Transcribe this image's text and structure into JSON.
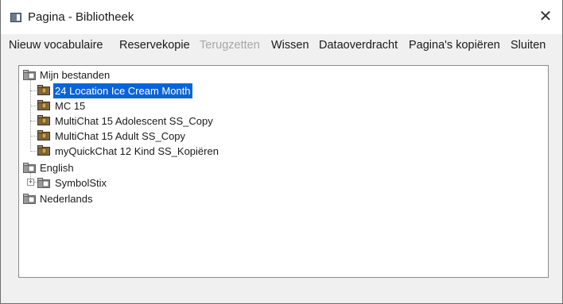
{
  "window": {
    "title": "Pagina - Bibliotheek",
    "icon": "app-window-icon",
    "close_glyph": "✕"
  },
  "menu": {
    "items": [
      {
        "label": "Nieuw vocabulaire",
        "enabled": true
      },
      {
        "label": "Reservekopie",
        "enabled": true
      },
      {
        "label": "Terugzetten",
        "enabled": false
      },
      {
        "label": "Wissen",
        "enabled": true
      },
      {
        "label": "Dataoverdracht",
        "enabled": true
      },
      {
        "label": "Pagina's kopiëren",
        "enabled": true
      },
      {
        "label": "Sluiten",
        "enabled": true
      }
    ]
  },
  "tree": {
    "nodes": [
      {
        "label": "Mijn bestanden",
        "level": 0,
        "icon": "folder-icon",
        "expanded": true
      },
      {
        "label": "24 Location Ice Cream Month",
        "level": 1,
        "icon": "vocabulary-icon",
        "selected": true
      },
      {
        "label": "MC 15",
        "level": 1,
        "icon": "vocabulary-icon"
      },
      {
        "label": "MultiChat 15 Adolescent SS_Copy",
        "level": 1,
        "icon": "vocabulary-icon"
      },
      {
        "label": "MultiChat 15 Adult SS_Copy",
        "level": 1,
        "icon": "vocabulary-icon"
      },
      {
        "label": "myQuickChat 12 Kind SS_Kopiëren",
        "level": 1,
        "icon": "vocabulary-icon"
      },
      {
        "label": "English",
        "level": 0,
        "icon": "folder-icon"
      },
      {
        "label": "SymbolStix",
        "level": 1,
        "icon": "folder-icon",
        "collapsed": true,
        "expander": "+"
      },
      {
        "label": "Nederlands",
        "level": 0,
        "icon": "folder-icon"
      }
    ]
  },
  "colors": {
    "selection": "#0a64d6",
    "disabled_text": "#a8a8a8",
    "folder": "#8a8a8a",
    "vocabulary": "#8b6a2e"
  }
}
